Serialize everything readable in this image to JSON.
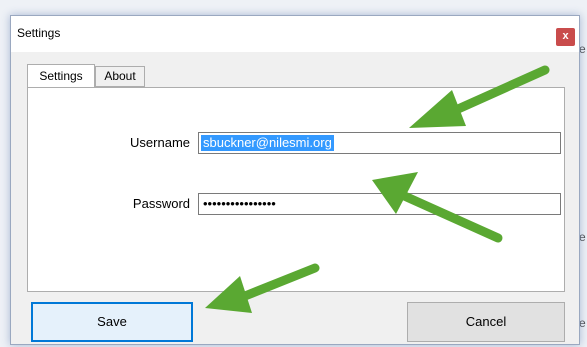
{
  "window": {
    "title": "Settings",
    "close_label": "x"
  },
  "tabs": [
    {
      "label": "Settings",
      "active": true
    },
    {
      "label": "About",
      "active": false
    }
  ],
  "form": {
    "username": {
      "label": "Username",
      "value": "sbuckner@nilesmi.org"
    },
    "password": {
      "label": "Password",
      "value": "••••••••••••••••"
    }
  },
  "buttons": {
    "save": "Save",
    "cancel": "Cancel"
  },
  "background": {
    "edge_chars": [
      "e",
      "e",
      "e"
    ]
  },
  "colors": {
    "arrow": "#5aa832",
    "selection": "#3399ff",
    "close": "#c94c4c",
    "focus_border": "#0078d7"
  }
}
